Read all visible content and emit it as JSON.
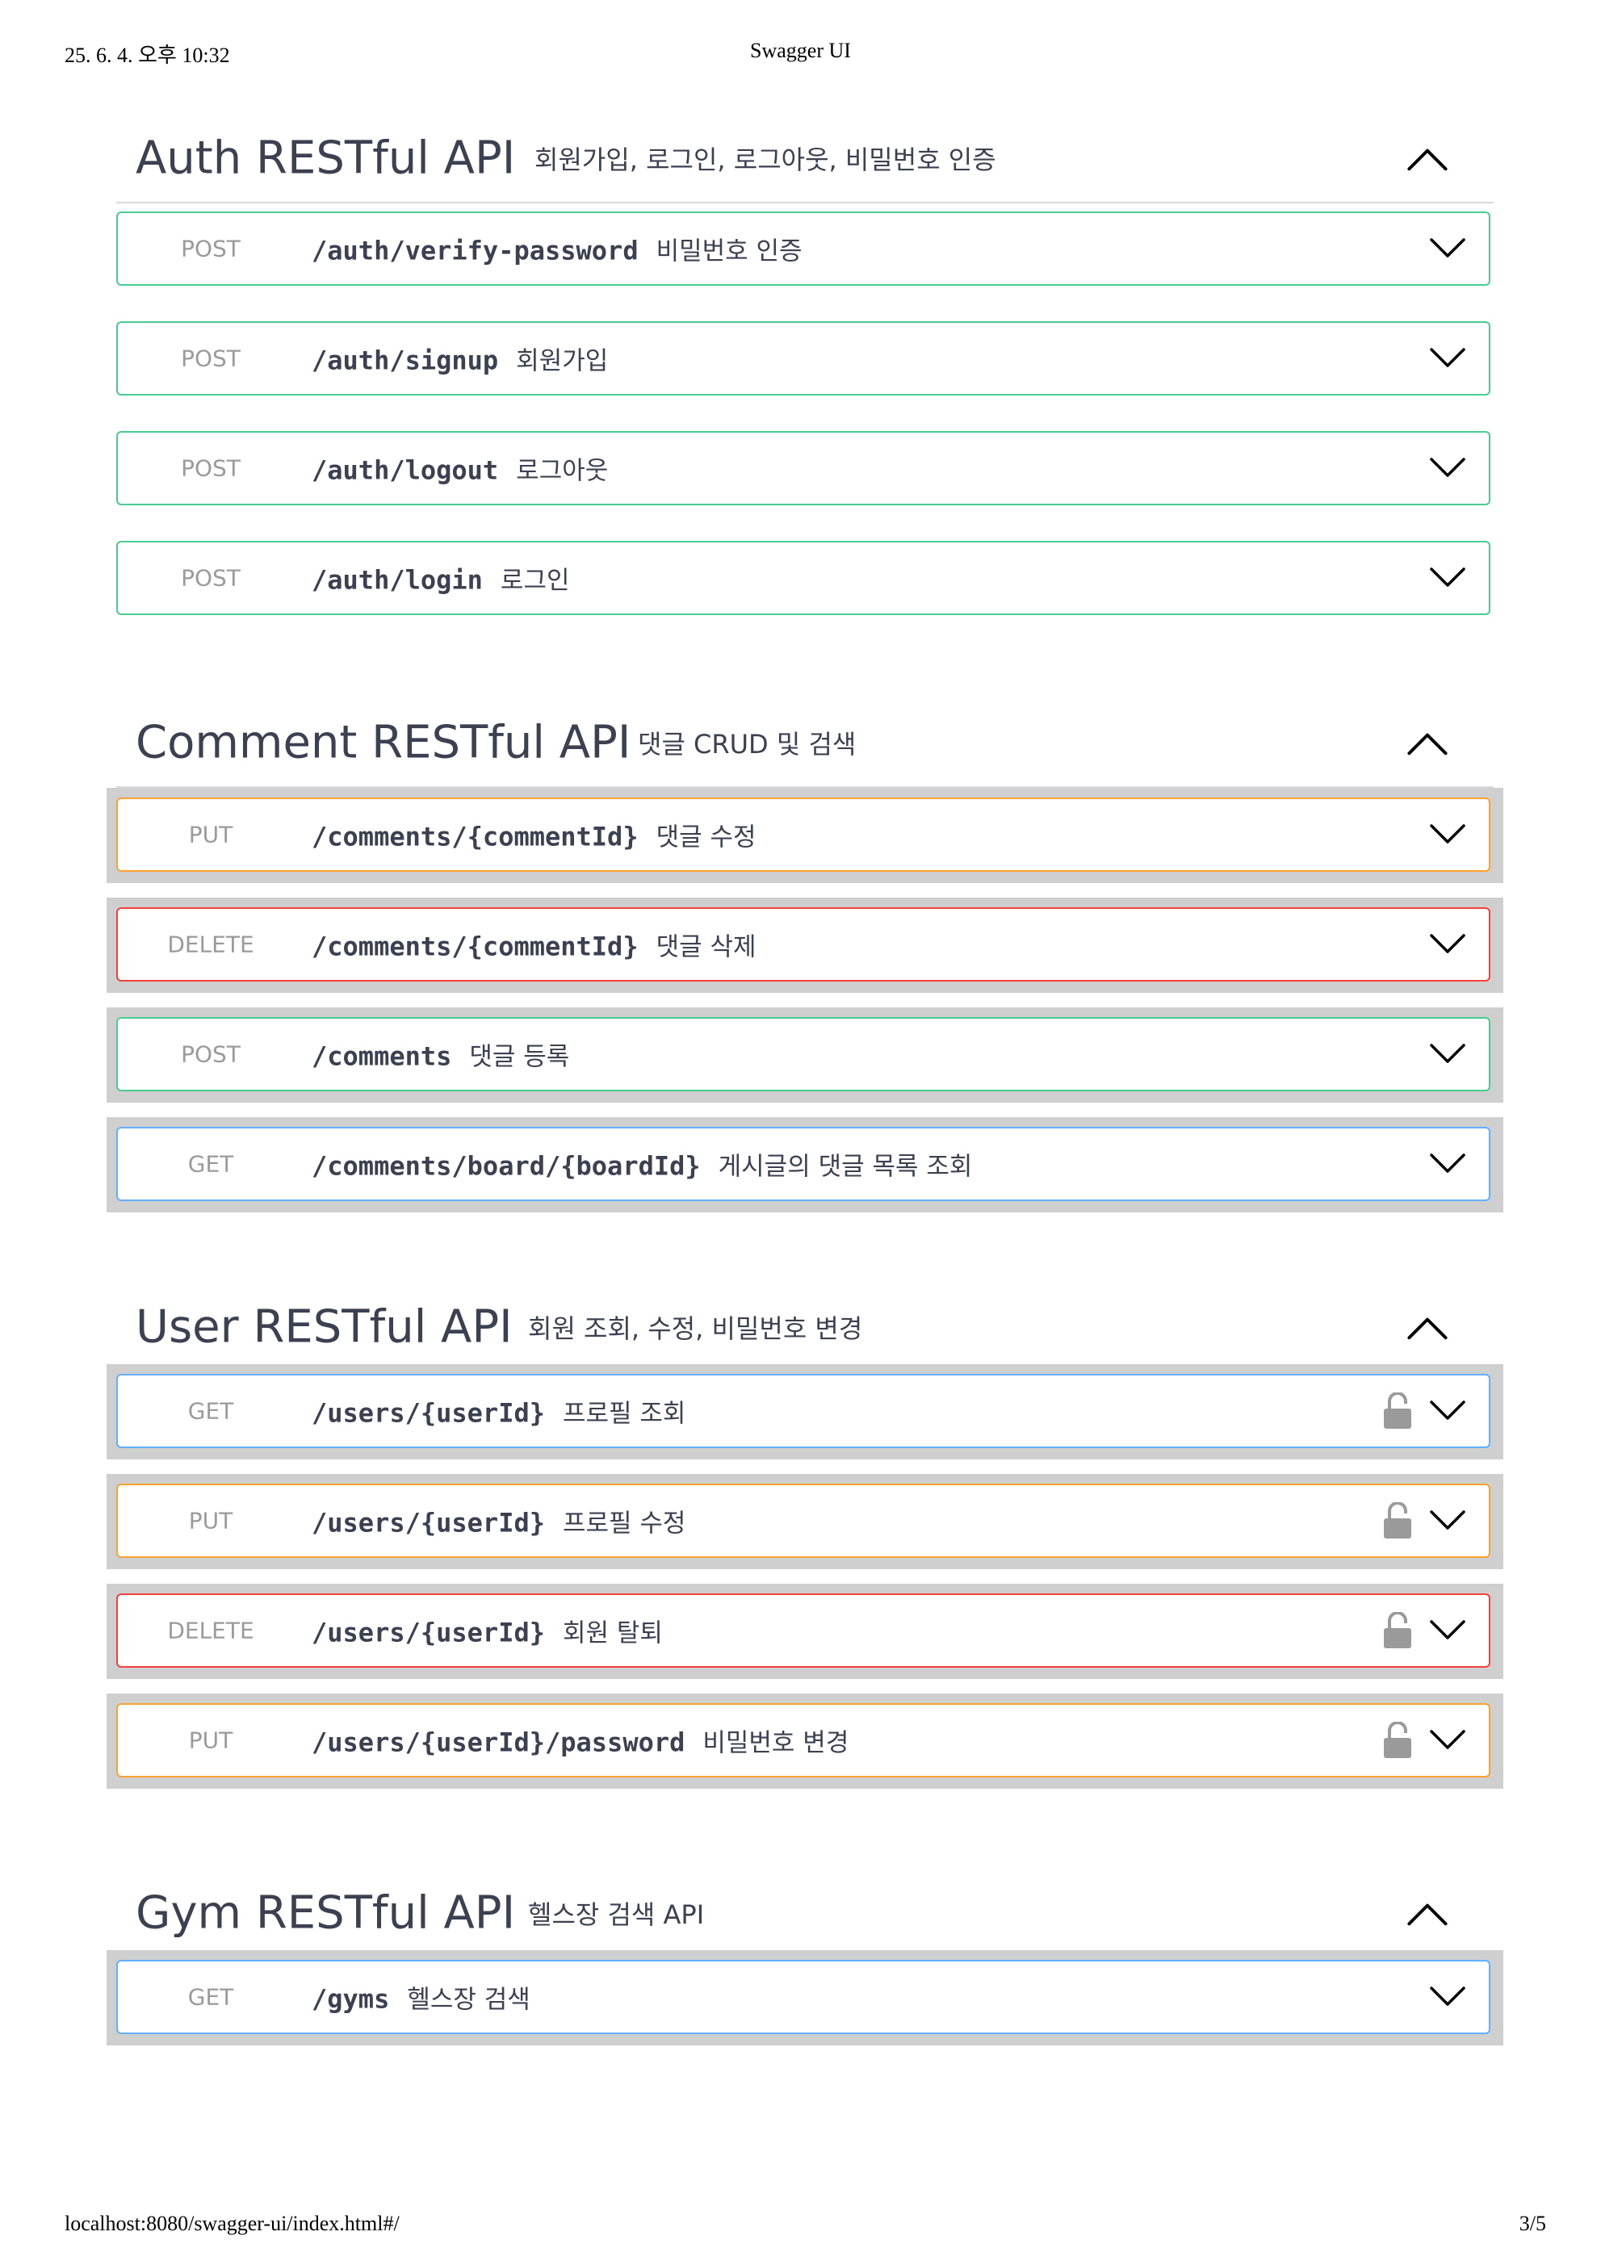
{
  "print": {
    "date": "25. 6. 4. 오후 10:32",
    "title": "Swagger UI",
    "url": "localhost:8080/swagger-ui/index.html#/",
    "page": "3/5"
  },
  "sections": [
    {
      "name": "Auth RESTful API",
      "description": "회원가입, 로그인, 로그아웃, 비밀번호 인증",
      "toggle_icon": "chevron-up-icon",
      "operations": [
        {
          "method": "POST",
          "path": "/auth/verify-password",
          "summary": "비밀번호 인증"
        },
        {
          "method": "POST",
          "path": "/auth/signup",
          "summary": "회원가입"
        },
        {
          "method": "POST",
          "path": "/auth/logout",
          "summary": "로그아웃"
        },
        {
          "method": "POST",
          "path": "/auth/login",
          "summary": "로그인"
        }
      ]
    },
    {
      "name": "Comment RESTful API",
      "description": "댓글 CRUD 및 검색",
      "toggle_icon": "chevron-up-icon",
      "operations": [
        {
          "method": "PUT",
          "path": "/comments/{commentId}",
          "summary": "댓글 수정"
        },
        {
          "method": "DELETE",
          "path": "/comments/{commentId}",
          "summary": "댓글 삭제"
        },
        {
          "method": "POST",
          "path": "/comments",
          "summary": "댓글 등록"
        },
        {
          "method": "GET",
          "path": "/comments/board/{boardId}",
          "summary": "게시글의 댓글 목록 조회"
        }
      ]
    },
    {
      "name": "User RESTful API",
      "description": "회원 조회, 수정, 비밀번호 변경",
      "toggle_icon": "chevron-up-icon",
      "operations": [
        {
          "method": "GET",
          "path": "/users/{userId}",
          "summary": "프로필 조회"
        },
        {
          "method": "PUT",
          "path": "/users/{userId}",
          "summary": "프로필 수정"
        },
        {
          "method": "DELETE",
          "path": "/users/{userId}",
          "summary": "회원 탈퇴"
        },
        {
          "method": "PUT",
          "path": "/users/{userId}/password",
          "summary": "비밀번호 변경"
        }
      ]
    },
    {
      "name": "Gym RESTful API",
      "description": "헬스장 검색 API",
      "toggle_icon": "chevron-up-icon",
      "operations": [
        {
          "method": "GET",
          "path": "/gyms",
          "summary": "헬스장 검색"
        }
      ]
    }
  ],
  "colors": {
    "post": "#49cc90",
    "put": "#fca130",
    "delete": "#f93e3e",
    "get": "#61affe",
    "lock": "#9a9a9a"
  }
}
